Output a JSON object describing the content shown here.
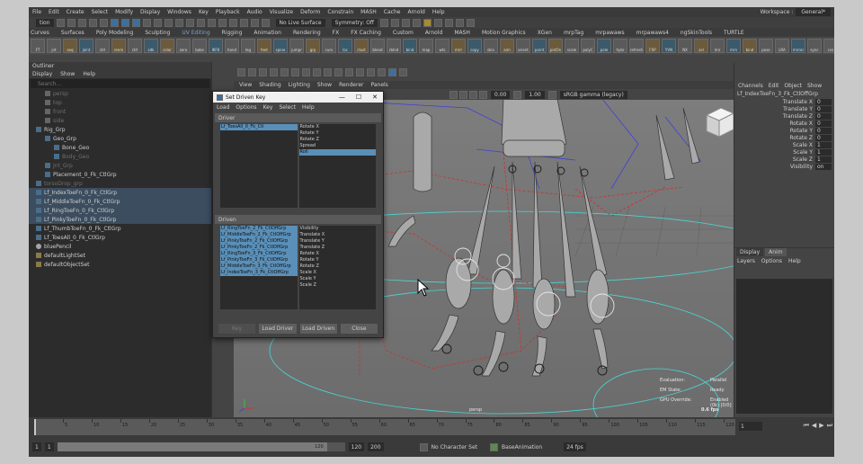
{
  "menubar": {
    "items": [
      "File",
      "Edit",
      "Create",
      "Select",
      "Modify",
      "Display",
      "Windows",
      "Key",
      "Playback",
      "Audio",
      "Visualize",
      "Deform",
      "Constrain",
      "MASH",
      "Cache",
      "Arnold",
      "Help"
    ],
    "workspace_label": "Workspace :",
    "workspace_value": "General*"
  },
  "statusline": {
    "mode": "tion",
    "live_surface": "No Live Surface",
    "symmetry": "Symmetry: Off"
  },
  "shelf": {
    "tabs": [
      "Curves",
      "Surfaces",
      "Poly Modeling",
      "Sculpting",
      "UV Editing",
      "Rigging",
      "Animation",
      "Rendering",
      "FX",
      "FX Caching",
      "Custom",
      "Arnold",
      "MASH",
      "Motion Graphics",
      "XGen",
      "mrpTag",
      "mrpawaws",
      "mrpawaws4",
      "ngSkinTools",
      "TURTLE"
    ],
    "active_tab": "UV Editing",
    "buttons": [
      "FT",
      "jnt",
      "seq",
      "joint",
      "ctrl",
      "renm",
      "ctrl",
      "sdk",
      "color",
      "zero",
      "bake",
      "IKFK",
      "hand",
      "leg",
      "feet",
      "spine",
      "jumpr",
      "grp",
      "curv",
      "loc",
      "clust",
      "blend",
      "rblnd",
      "bind",
      "map",
      "wts",
      "mirr",
      "copy",
      "skin",
      "aim",
      "orient",
      "parnt",
      "pntOn",
      "scale",
      "polyC",
      "pole",
      "hybr",
      "refresh",
      "FXP",
      "YVN",
      "NX",
      "sel",
      "mir",
      "mrn",
      "bind",
      "pose",
      "LRA",
      "mirror",
      "sync",
      "cvs",
      "soft",
      "norm",
      "proxy",
      "jnt",
      "prev",
      "lock",
      "hide",
      "poly",
      "fix",
      "cl"
    ]
  },
  "outliner": {
    "title": "Outliner",
    "menu": [
      "Display",
      "Show",
      "Help"
    ],
    "search_placeholder": "Search...",
    "items": [
      {
        "label": "persp",
        "indent": 1,
        "icon": "cam",
        "dim": true,
        "selected": false
      },
      {
        "label": "top",
        "indent": 1,
        "icon": "cam",
        "dim": true,
        "selected": false
      },
      {
        "label": "front",
        "indent": 1,
        "icon": "cam",
        "dim": true,
        "selected": false
      },
      {
        "label": "side",
        "indent": 1,
        "icon": "cam",
        "dim": true,
        "selected": false
      },
      {
        "label": "Rig_Grp",
        "indent": 0,
        "icon": "grp",
        "dim": false,
        "selected": false
      },
      {
        "label": "Geo_Grp",
        "indent": 1,
        "icon": "grp",
        "dim": false,
        "selected": false
      },
      {
        "label": "Bone_Geo",
        "indent": 2,
        "icon": "grp",
        "dim": false,
        "selected": false
      },
      {
        "label": "Body_Geo",
        "indent": 2,
        "icon": "grp",
        "dim": true,
        "selected": false
      },
      {
        "label": "Jnt_Grp",
        "indent": 1,
        "icon": "grp",
        "dim": true,
        "selected": false
      },
      {
        "label": "Placement_0_Fk_CtlGrp",
        "indent": 1,
        "icon": "grp",
        "dim": false,
        "selected": false
      },
      {
        "label": "torsoDrop_grp",
        "indent": 0,
        "icon": "grp",
        "dim": true,
        "selected": false
      },
      {
        "label": "Lf_IndexToeFn_0_Fk_CtlGrp",
        "indent": 0,
        "icon": "grp",
        "dim": false,
        "selected": true
      },
      {
        "label": "Lf_MiddleToeFn_0_Fk_CtlGrp",
        "indent": 0,
        "icon": "grp",
        "dim": false,
        "selected": true
      },
      {
        "label": "Lf_RingToeFn_0_Fk_CtlGrp",
        "indent": 0,
        "icon": "grp",
        "dim": false,
        "selected": true
      },
      {
        "label": "Lf_PinkyToeFn_0_Fk_CtlGrp",
        "indent": 0,
        "icon": "grp",
        "dim": false,
        "selected": true
      },
      {
        "label": "Lf_ThumbToeFn_0_Fk_CtlGrp",
        "indent": 0,
        "icon": "grp",
        "dim": false,
        "selected": false
      },
      {
        "label": "Lf_ToesAll_0_Fk_CtlGrp",
        "indent": 0,
        "icon": "grp",
        "dim": false,
        "selected": false
      },
      {
        "label": "bluePencil",
        "indent": 0,
        "icon": "jnt",
        "dim": false,
        "selected": false
      },
      {
        "label": "defaultLightSet",
        "indent": 0,
        "icon": "set",
        "dim": false,
        "selected": false
      },
      {
        "label": "defaultObjectSet",
        "indent": 0,
        "icon": "set",
        "dim": false,
        "selected": false
      }
    ]
  },
  "viewport": {
    "menu": [
      "View",
      "Shading",
      "Lighting",
      "Show",
      "Renderer",
      "Panels"
    ],
    "field1": "0.00",
    "field2": "1.00",
    "colorspace": "sRGB gamma (legacy)",
    "camera": "persp",
    "hud": {
      "evaluation_label": "Evaluation:",
      "evaluation_value": "Parallel",
      "em_label": "EM State:",
      "em_value": "Ready",
      "gpu_label": "GPU Override:",
      "gpu_value": "Enabled (0k) [0/0]",
      "fps": "0.6 fps"
    }
  },
  "sdk": {
    "title": "Set Driven Key",
    "controls": [
      "—",
      "☐",
      "✕"
    ],
    "menu": [
      "Load",
      "Options",
      "Key",
      "Select",
      "Help"
    ],
    "driver_label": "Driver",
    "driven_label": "Driven",
    "driver_nodes": [
      "Lf_ToesAll_0_Fk_Ctl"
    ],
    "driver_attrs": [
      "Rotate X",
      "Rotate Y",
      "Rotate Z",
      "Spread",
      "Roll"
    ],
    "driven_nodes": [
      "Lf_RingToeFn_2_Fk_CtlOffGrp",
      "Lf_MiddleToeFn_2_Fk_CtlOffGrp",
      "Lf_PinkyToeFn_2_Fk_CtlOffGrp",
      "Lf_PinkyToeFn_2_Fk_CtlOffGrp",
      "Lf_RingToeFn_3_Fk_CtlOffGrp",
      "Lf_PinkyToeFn_3_Fk_CtlOffGrp",
      "Lf_MiddleToeFn_3_Fk_CtlOffGrp",
      "Lf_IndexToeFn_3_Fk_CtlOffGrp"
    ],
    "driven_attrs": [
      "Visibility",
      "Translate X",
      "Translate Y",
      "Translate Z",
      "Rotate X",
      "Rotate Y",
      "Rotate Z",
      "Scale X",
      "Scale Y",
      "Scale Z"
    ],
    "buttons": [
      "Key",
      "Load Driver",
      "Load Driven",
      "Close"
    ]
  },
  "chanbox": {
    "menu": [
      "Channels",
      "Edit",
      "Object",
      "Show"
    ],
    "node": "Lf_IndexToeFn_3_Fk_CtlOffGrp",
    "attrs": [
      {
        "name": "Translate X",
        "value": "0"
      },
      {
        "name": "Translate Y",
        "value": "0"
      },
      {
        "name": "Translate Z",
        "value": "0"
      },
      {
        "name": "Rotate X",
        "value": "0"
      },
      {
        "name": "Rotate Y",
        "value": "0"
      },
      {
        "name": "Rotate Z",
        "value": "0"
      },
      {
        "name": "Scale X",
        "value": "1"
      },
      {
        "name": "Scale Y",
        "value": "1"
      },
      {
        "name": "Scale Z",
        "value": "1"
      },
      {
        "name": "Visibility",
        "value": "on"
      }
    ],
    "layer_tabs": [
      "Display",
      "Anim"
    ],
    "layer_menu": [
      "Layers",
      "Options",
      "Help"
    ]
  },
  "timeslider": {
    "ticks": [
      "5",
      "10",
      "15",
      "20",
      "25",
      "30",
      "35",
      "40",
      "45",
      "50",
      "55",
      "60",
      "65",
      "70",
      "75",
      "80",
      "85",
      "90",
      "95",
      "100",
      "105",
      "110",
      "115",
      "120"
    ],
    "current": "1"
  },
  "range": {
    "start": "1",
    "inner_start": "1",
    "inner_end": "120",
    "end_mid": "120",
    "end": "200",
    "character_set": "No Character Set",
    "anim_layer": "BaseAnimation",
    "fps": "24 fps"
  }
}
